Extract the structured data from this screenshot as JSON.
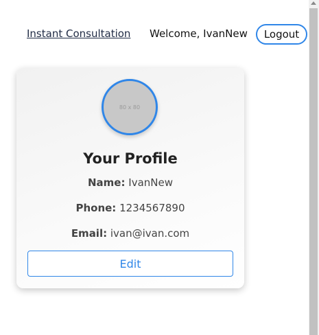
{
  "nav": {
    "link_label": "Instant Consultation",
    "welcome_text": "Welcome, IvanNew",
    "logout_label": "Logout"
  },
  "profile": {
    "avatar_placeholder": "80 x 80",
    "title": "Your Profile",
    "name_label": "Name:",
    "name_value": "IvanNew",
    "phone_label": "Phone:",
    "phone_value": "1234567890",
    "email_label": "Email:",
    "email_value": "ivan@ivan.com",
    "edit_label": "Edit"
  },
  "colors": {
    "accent": "#2f86e8",
    "avatar_fill": "#c8c8c8",
    "card_background": "#f4f4f4"
  },
  "icons": {
    "scroll_up": "scroll-up-arrow-icon"
  }
}
